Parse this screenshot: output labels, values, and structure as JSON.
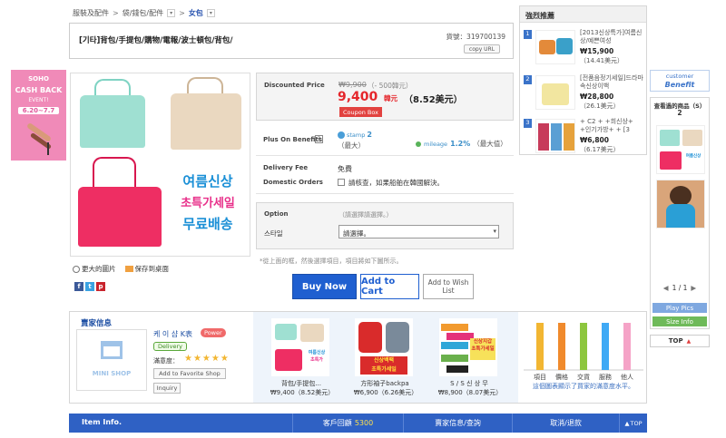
{
  "breadcrumb": {
    "items": [
      "服裝及配件",
      "袋/錢包/配件",
      "女包"
    ]
  },
  "product": {
    "title": "[기타]背包/手提包/購物/電報/波士頓包/背包/",
    "item_no_label": "貨號：319700139",
    "copy_url_label": "copy URL",
    "promo_lines": [
      "여름신상",
      "초특가세일",
      "무료배송"
    ],
    "view_larger": "更大的圖片",
    "save_desktop": "保存到桌面"
  },
  "price": {
    "discounted_label": "Discounted Price",
    "original": "₩9,900",
    "discount_note": "（- 500韓元）",
    "current": "9,400",
    "currency": "韓元",
    "usd": "（8.52美元）",
    "coupon_label": "Coupon Box"
  },
  "benefits": {
    "label": "Plus On Benefits",
    "help": "?",
    "stamp_text": "stamp",
    "stamp_value": "2",
    "stamp_note": "（最大）",
    "mileage_text": "mileage",
    "mileage_value": "1.2%",
    "mileage_note": "（最大值）"
  },
  "delivery": {
    "fee_label": "Delivery Fee",
    "fee_value": "免費",
    "domestic_label": "Domestic Orders",
    "domestic_value": "請核查，如果船舶在韓國解決。"
  },
  "option": {
    "label": "Option",
    "hint": "（請選擇請選擇。）",
    "style_label": "스타일",
    "select_value": "請選擇。"
  },
  "notice": "*從上面的框，然後選擇項目，項目將如下圖所示。",
  "actions": {
    "buy_now": "Buy Now",
    "add_to_cart": "Add to Cart",
    "add_to_wishlist": "Add to Wish List"
  },
  "share_icons": [
    "f",
    "t",
    "p"
  ],
  "seller": {
    "section_title": "賣家信息",
    "shop_logo_text": "MINI SHOP",
    "name": "케 이 샵 K表",
    "power_badge": "Power",
    "delivery_badge": "Delivery",
    "satisfaction_label": "滿意度：",
    "stars": "★★★★★",
    "favorite_button": "Add to Favorite Shop",
    "inquiry_button": "Inquiry"
  },
  "related": [
    {
      "name": "背包/手提包...",
      "price": "₩9,400（8.52美元）"
    },
    {
      "name": "方形袖子backpa",
      "price": "₩6,900（6.26美元）"
    },
    {
      "name": "S / S 신 상 무",
      "price": "₩8,900（8.07美元）"
    }
  ],
  "chart": {
    "labels": [
      "項目",
      "價格",
      "交貨",
      "服務",
      "他人"
    ],
    "caption": "這個圖表顯示了買家的滿意度水平。"
  },
  "chart_data": {
    "type": "bar",
    "categories": [
      "項目",
      "價格",
      "交貨",
      "服務",
      "他人"
    ],
    "values": [
      5,
      5,
      5,
      5,
      5
    ],
    "ylim": [
      0,
      5
    ],
    "colors": [
      "#f2b632",
      "#f08a2c",
      "#8dc63f",
      "#3fa9f5",
      "#f5a3c7"
    ]
  },
  "bottom_bar": {
    "item_info": "Item Info.",
    "reviews_label": "客戶回顧",
    "reviews_count": "5300",
    "seller_info": "賣家信息/查詢",
    "cancel": "取消/退款",
    "top": "TOP"
  },
  "recommend": {
    "title": "強烈推薦",
    "items": [
      {
        "rank": "1",
        "name": "[2013신상특가]여름신상/예쁜여성",
        "price": "₩15,900",
        "usd": "（14.41美元）"
      },
      {
        "rank": "2",
        "name": "[전품음정기세일]드라마속신상이백",
        "price": "₩28,800",
        "usd": "（26.1美元）"
      },
      {
        "rank": "3",
        "name": "+ C2 + +희신상+ +인기가방+ + [3",
        "price": "₩6,800",
        "usd": "（6.17美元）"
      }
    ]
  },
  "left_banner": {
    "line1": "SOHO",
    "line2": "CASH BACK",
    "line3": "EVENT!",
    "dates": "6.20~7.7"
  },
  "right_panel": {
    "customer_benefit_1": "customer",
    "customer_benefit_2": "Benefit",
    "viewed_title": "查看過的商品（S）",
    "viewed_count": "2",
    "pager": "1 / 1",
    "play_pics": "Play Pics",
    "size_info": "Size Info",
    "top": "TOP"
  }
}
